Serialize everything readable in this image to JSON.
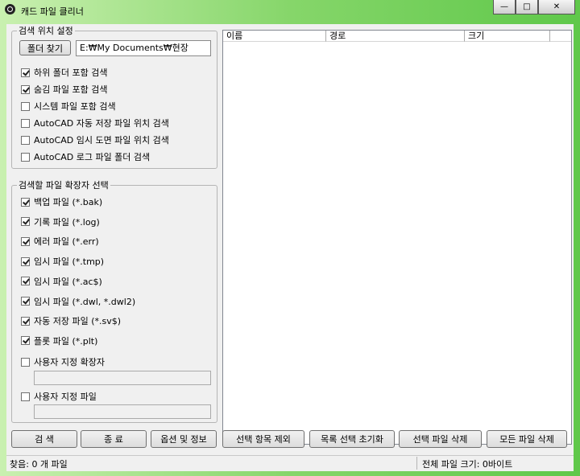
{
  "window": {
    "title": "캐드 파일 클리너"
  },
  "search_location": {
    "legend": "검색 위치 설정",
    "folder_button": "폴더 찾기",
    "path_value": "E:₩My Documents₩현장",
    "options": [
      {
        "label": "하위 폴더 포함 검색",
        "checked": true
      },
      {
        "label": "숨김 파일 포함 검색",
        "checked": true
      },
      {
        "label": "시스템 파일 포함 검색",
        "checked": false
      },
      {
        "label": "AutoCAD 자동 저장 파일 위치 검색",
        "checked": false
      },
      {
        "label": "AutoCAD 임시 도면 파일 위치 검색",
        "checked": false
      },
      {
        "label": "AutoCAD 로그 파일 폴더 검색",
        "checked": false
      }
    ]
  },
  "extensions": {
    "legend": "검색할 파일 확장자 선택",
    "options": [
      {
        "label": "백업 파일 (*.bak)",
        "checked": true
      },
      {
        "label": "기록 파일 (*.log)",
        "checked": true
      },
      {
        "label": "에러 파일 (*.err)",
        "checked": true
      },
      {
        "label": "임시 파일 (*.tmp)",
        "checked": true
      },
      {
        "label": "임시 파일 (*.ac$)",
        "checked": true
      },
      {
        "label": "임시 파일 (*.dwl, *.dwl2)",
        "checked": true
      },
      {
        "label": "자동 저장 파일 (*.sv$)",
        "checked": true
      },
      {
        "label": "플롯 파일 (*.plt)",
        "checked": true
      }
    ],
    "custom_ext": {
      "label": "사용자 지정 확장자",
      "checked": false,
      "value": ""
    },
    "custom_file": {
      "label": "사용자 지정 파일",
      "checked": false,
      "value": ""
    }
  },
  "file_list": {
    "columns": [
      "이름",
      "경로",
      "크기",
      ""
    ],
    "rows": []
  },
  "buttons": {
    "search": "검 색",
    "exit": "종 료",
    "options": "옵션 및 정보",
    "exclude_selected": "선택 항목 제외",
    "reset_selection": "목록 선택 초기화",
    "delete_selected": "선택 파일 삭제",
    "delete_all": "모든 파일 삭제"
  },
  "status": {
    "found": "찾음: 0 개 파일",
    "total_size": "전체 파일 크기: 0바이트"
  }
}
